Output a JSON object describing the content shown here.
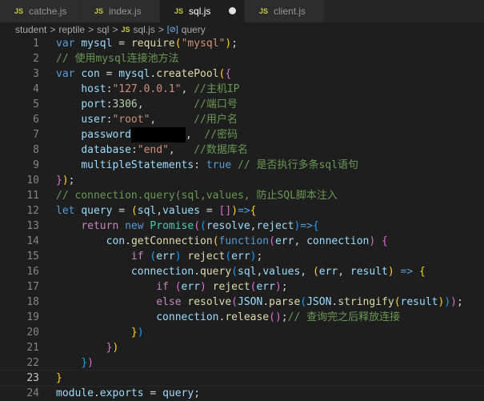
{
  "tabs": [
    {
      "label": "catche.js",
      "icon": "js-icon"
    },
    {
      "label": "index.js",
      "icon": "js-icon"
    },
    {
      "label": "sql.js",
      "icon": "js-icon",
      "active": true,
      "modified": true
    },
    {
      "label": "client.js",
      "icon": "js-icon"
    }
  ],
  "breadcrumb": {
    "parts": [
      "student",
      "reptile",
      "sql"
    ],
    "file": "sql.js",
    "symbol": "query",
    "js_badge": "JS",
    "sep": ">"
  },
  "colors": {
    "kw": "#569cd6",
    "var": "#9cdcfe",
    "str": "#ce9178",
    "cm": "#6a9955",
    "fn": "#dcdcaa",
    "num": "#b5cea8",
    "p": "#d4d4d4",
    "b1": "#ffd700",
    "b2": "#da70d6",
    "b3": "#179fff",
    "ctl": "#c586c0",
    "cls": "#4ec9b0"
  },
  "code": [
    [
      [
        "kw",
        "var "
      ],
      [
        "var",
        "mysql"
      ],
      [
        "p",
        " = "
      ],
      [
        "fn",
        "require"
      ],
      [
        "b1",
        "("
      ],
      [
        "str",
        "\"mysql\""
      ],
      [
        "b1",
        ")"
      ],
      [
        "p",
        ";"
      ]
    ],
    [
      [
        "cm",
        "// 使用mysql连接池方法"
      ]
    ],
    [
      [
        "kw",
        "var "
      ],
      [
        "var",
        "con"
      ],
      [
        "p",
        " = "
      ],
      [
        "var",
        "mysql"
      ],
      [
        "p",
        "."
      ],
      [
        "fn",
        "createPool"
      ],
      [
        "b1",
        "("
      ],
      [
        "b2",
        "{"
      ]
    ],
    [
      [
        "p",
        "    "
      ],
      [
        "var",
        "host"
      ],
      [
        "p",
        ":"
      ],
      [
        "str",
        "\"127.0.0.1\""
      ],
      [
        "p",
        ", "
      ],
      [
        "cm",
        "//主机IP"
      ]
    ],
    [
      [
        "p",
        "    "
      ],
      [
        "var",
        "port"
      ],
      [
        "p",
        ":"
      ],
      [
        "num",
        "3306"
      ],
      [
        "p",
        ",        "
      ],
      [
        "cm",
        "//端口号"
      ]
    ],
    [
      [
        "p",
        "    "
      ],
      [
        "var",
        "user"
      ],
      [
        "p",
        ":"
      ],
      [
        "str",
        "\"root\""
      ],
      [
        "p",
        ",      "
      ],
      [
        "cm",
        "//用户名"
      ]
    ],
    [
      [
        "p",
        "    "
      ],
      [
        "var",
        "password"
      ],
      [
        "redact",
        ""
      ],
      [
        "p",
        ",  "
      ],
      [
        "cm",
        "//密码"
      ]
    ],
    [
      [
        "p",
        "    "
      ],
      [
        "var",
        "database"
      ],
      [
        "p",
        ":"
      ],
      [
        "str",
        "\"end\""
      ],
      [
        "p",
        ",   "
      ],
      [
        "cm",
        "//数据库名"
      ]
    ],
    [
      [
        "p",
        "    "
      ],
      [
        "var",
        "multipleStatements"
      ],
      [
        "p",
        ": "
      ],
      [
        "kw",
        "true"
      ],
      [
        "p",
        " "
      ],
      [
        "cm",
        "// 是否执行多条sql语句"
      ]
    ],
    [
      [
        "b2",
        "}"
      ],
      [
        "b1",
        ")"
      ],
      [
        "p",
        ";"
      ]
    ],
    [
      [
        "cm",
        "// connection.query(sql,values, 防止SQL脚本注入"
      ]
    ],
    [
      [
        "kw",
        "let "
      ],
      [
        "var",
        "query"
      ],
      [
        "p",
        " = "
      ],
      [
        "b1",
        "("
      ],
      [
        "var",
        "sql"
      ],
      [
        "p",
        ","
      ],
      [
        "var",
        "values"
      ],
      [
        "p",
        " = "
      ],
      [
        "b2",
        "[]"
      ],
      [
        "b1",
        ")"
      ],
      [
        "kw",
        "=>"
      ],
      [
        "b1",
        "{"
      ]
    ],
    [
      [
        "p",
        "    "
      ],
      [
        "ctl",
        "return "
      ],
      [
        "kw",
        "new "
      ],
      [
        "cls",
        "Promise"
      ],
      [
        "b2",
        "("
      ],
      [
        "b3",
        "("
      ],
      [
        "var",
        "resolve"
      ],
      [
        "p",
        ","
      ],
      [
        "var",
        "reject"
      ],
      [
        "b3",
        ")"
      ],
      [
        "kw",
        "=>"
      ],
      [
        "b3",
        "{"
      ]
    ],
    [
      [
        "p",
        "        "
      ],
      [
        "var",
        "con"
      ],
      [
        "p",
        "."
      ],
      [
        "fn",
        "getConnection"
      ],
      [
        "b1",
        "("
      ],
      [
        "kw",
        "function"
      ],
      [
        "b2",
        "("
      ],
      [
        "var",
        "err"
      ],
      [
        "p",
        ", "
      ],
      [
        "var",
        "connection"
      ],
      [
        "b2",
        ")"
      ],
      [
        "p",
        " "
      ],
      [
        "b2",
        "{"
      ]
    ],
    [
      [
        "p",
        "            "
      ],
      [
        "ctl",
        "if "
      ],
      [
        "b3",
        "("
      ],
      [
        "var",
        "err"
      ],
      [
        "b3",
        ")"
      ],
      [
        "p",
        " "
      ],
      [
        "fn",
        "reject"
      ],
      [
        "b3",
        "("
      ],
      [
        "var",
        "err"
      ],
      [
        "b3",
        ")"
      ],
      [
        "p",
        ";"
      ]
    ],
    [
      [
        "p",
        "            "
      ],
      [
        "var",
        "connection"
      ],
      [
        "p",
        "."
      ],
      [
        "fn",
        "query"
      ],
      [
        "b3",
        "("
      ],
      [
        "var",
        "sql"
      ],
      [
        "p",
        ","
      ],
      [
        "var",
        "values"
      ],
      [
        "p",
        ", "
      ],
      [
        "b1",
        "("
      ],
      [
        "var",
        "err"
      ],
      [
        "p",
        ", "
      ],
      [
        "var",
        "result"
      ],
      [
        "b1",
        ")"
      ],
      [
        "p",
        " "
      ],
      [
        "kw",
        "=>"
      ],
      [
        "p",
        " "
      ],
      [
        "b1",
        "{"
      ]
    ],
    [
      [
        "p",
        "                "
      ],
      [
        "ctl",
        "if "
      ],
      [
        "b2",
        "("
      ],
      [
        "var",
        "err"
      ],
      [
        "b2",
        ")"
      ],
      [
        "p",
        " "
      ],
      [
        "fn",
        "reject"
      ],
      [
        "b2",
        "("
      ],
      [
        "var",
        "err"
      ],
      [
        "b2",
        ")"
      ],
      [
        "p",
        ";"
      ]
    ],
    [
      [
        "p",
        "                "
      ],
      [
        "ctl",
        "else "
      ],
      [
        "fn",
        "resolve"
      ],
      [
        "b2",
        "("
      ],
      [
        "var",
        "JSON"
      ],
      [
        "p",
        "."
      ],
      [
        "fn",
        "parse"
      ],
      [
        "b3",
        "("
      ],
      [
        "var",
        "JSON"
      ],
      [
        "p",
        "."
      ],
      [
        "fn",
        "stringify"
      ],
      [
        "b1",
        "("
      ],
      [
        "var",
        "result"
      ],
      [
        "b1",
        ")"
      ],
      [
        "b3",
        ")"
      ],
      [
        "b2",
        ")"
      ],
      [
        "p",
        ";"
      ]
    ],
    [
      [
        "p",
        "                "
      ],
      [
        "var",
        "connection"
      ],
      [
        "p",
        "."
      ],
      [
        "fn",
        "release"
      ],
      [
        "b2",
        "()"
      ],
      [
        "p",
        ";"
      ],
      [
        "cm",
        "// 查询完之后释放连接"
      ]
    ],
    [
      [
        "p",
        "            "
      ],
      [
        "b1",
        "}"
      ],
      [
        "b3",
        ")"
      ]
    ],
    [
      [
        "p",
        "        "
      ],
      [
        "b2",
        "}"
      ],
      [
        "b1",
        ")"
      ]
    ],
    [
      [
        "p",
        "    "
      ],
      [
        "b3",
        "}"
      ],
      [
        "b2",
        ")"
      ]
    ],
    [
      [
        "b1",
        "}"
      ]
    ],
    [
      [
        "var",
        "module"
      ],
      [
        "p",
        "."
      ],
      [
        "var",
        "exports"
      ],
      [
        "p",
        " = "
      ],
      [
        "var",
        "query"
      ],
      [
        "p",
        ";"
      ]
    ]
  ],
  "current_line": 23
}
